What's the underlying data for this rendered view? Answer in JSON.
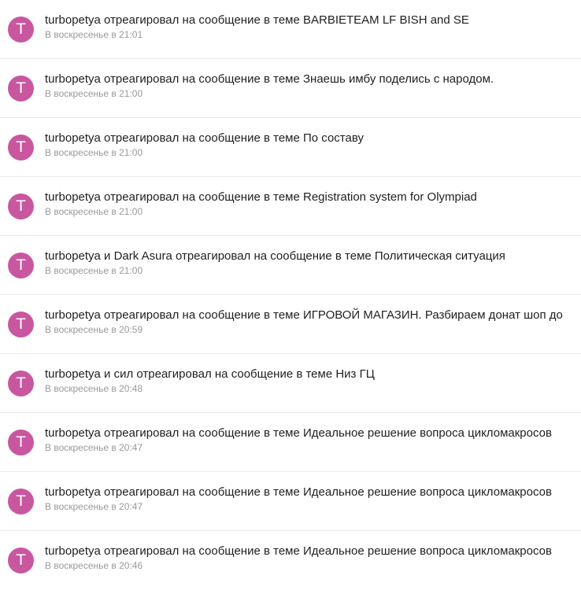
{
  "notifications": [
    {
      "avatar_letter": "T",
      "text": "turbopetya отреагировал на сообщение в теме BARBIETEAM LF BISH and SE",
      "time": "В воскресенье в 21:01"
    },
    {
      "avatar_letter": "T",
      "text": "turbopetya отреагировал на сообщение в теме Знаешь имбу поделись с народом.",
      "time": "В воскресенье в 21:00"
    },
    {
      "avatar_letter": "T",
      "text": "turbopetya отреагировал на сообщение в теме По составу",
      "time": "В воскресенье в 21:00"
    },
    {
      "avatar_letter": "T",
      "text": "turbopetya отреагировал на сообщение в теме Registration system for Olympiad",
      "time": "В воскресенье в 21:00"
    },
    {
      "avatar_letter": "T",
      "text": "turbopetya и Dark Asura отреагировал на сообщение в теме Политическая ситуация",
      "time": "В воскресенье в 21:00"
    },
    {
      "avatar_letter": "T",
      "text": "turbopetya отреагировал на сообщение в теме ИГРОВОЙ МАГАЗИН. Разбираем донат шоп до",
      "time": "В воскресенье в 20:59"
    },
    {
      "avatar_letter": "T",
      "text": "turbopetya и сил отреагировал на сообщение в теме Низ ГЦ",
      "time": "В воскресенье в 20:48"
    },
    {
      "avatar_letter": "T",
      "text": "turbopetya отреагировал на сообщение в теме Идеальное решение вопроса цикломакросов",
      "time": "В воскресенье в 20:47"
    },
    {
      "avatar_letter": "T",
      "text": "turbopetya отреагировал на сообщение в теме Идеальное решение вопроса цикломакросов",
      "time": "В воскресенье в 20:47"
    },
    {
      "avatar_letter": "T",
      "text": "turbopetya отреагировал на сообщение в теме Идеальное решение вопроса цикломакросов",
      "time": "В воскресенье в 20:46"
    }
  ],
  "colors": {
    "avatar_background": "#c9579f",
    "text": "#1f1f1f",
    "timestamp": "#9a9a9a",
    "divider": "#ececec"
  }
}
